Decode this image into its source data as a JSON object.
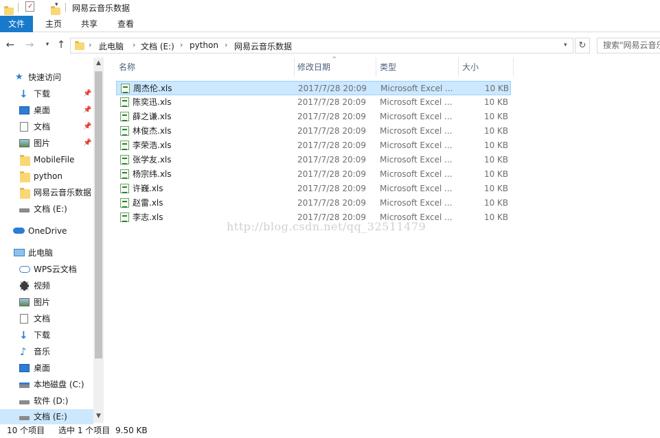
{
  "window": {
    "title": "网易云音乐数据"
  },
  "ribbon": {
    "tabs": [
      {
        "label": "文件"
      },
      {
        "label": "主页"
      },
      {
        "label": "共享"
      },
      {
        "label": "查看"
      }
    ]
  },
  "address": {
    "crumbs": [
      "此电脑",
      "文档 (E:)",
      "python",
      "网易云音乐数据"
    ],
    "search_placeholder": "搜索\"网易云音乐数据\""
  },
  "sidebar": {
    "items": [
      {
        "label": "快速访问",
        "icon": "star-icon"
      },
      {
        "label": "下载",
        "icon": "download-arrow-icon",
        "pinned": true
      },
      {
        "label": "桌面",
        "icon": "desktop-icon",
        "pinned": true
      },
      {
        "label": "文档",
        "icon": "document-icon",
        "pinned": true
      },
      {
        "label": "图片",
        "icon": "picture-icon",
        "pinned": true
      },
      {
        "label": "MobileFile",
        "icon": "folder-icon"
      },
      {
        "label": "python",
        "icon": "folder-icon"
      },
      {
        "label": "网易云音乐数据",
        "icon": "folder-icon"
      },
      {
        "label": "文档 (E:)",
        "icon": "drive-icon"
      },
      {
        "label": "OneDrive",
        "icon": "cloud-icon"
      },
      {
        "label": "此电脑",
        "icon": "computer-icon"
      },
      {
        "label": "WPS云文档",
        "icon": "wps-cloud-icon"
      },
      {
        "label": "视频",
        "icon": "video-icon"
      },
      {
        "label": "图片",
        "icon": "picture-icon"
      },
      {
        "label": "文档",
        "icon": "document-icon"
      },
      {
        "label": "下载",
        "icon": "download-arrow-icon"
      },
      {
        "label": "音乐",
        "icon": "music-note-icon"
      },
      {
        "label": "桌面",
        "icon": "desktop-icon"
      },
      {
        "label": "本地磁盘 (C:)",
        "icon": "drive-icon"
      },
      {
        "label": "软件 (D:)",
        "icon": "drive-icon"
      },
      {
        "label": "文档 (E:)",
        "icon": "drive-icon"
      }
    ]
  },
  "filelist": {
    "columns": {
      "name": "名称",
      "date": "修改日期",
      "type": "类型",
      "size": "大小"
    },
    "files": [
      {
        "name": "周杰伦.xls",
        "date": "2017/7/28 20:09",
        "type": "Microsoft Excel ...",
        "size": "10 KB"
      },
      {
        "name": "陈奕迅.xls",
        "date": "2017/7/28 20:09",
        "type": "Microsoft Excel ...",
        "size": "10 KB"
      },
      {
        "name": "薛之谦.xls",
        "date": "2017/7/28 20:09",
        "type": "Microsoft Excel ...",
        "size": "10 KB"
      },
      {
        "name": "林俊杰.xls",
        "date": "2017/7/28 20:09",
        "type": "Microsoft Excel ...",
        "size": "10 KB"
      },
      {
        "name": "李荣浩.xls",
        "date": "2017/7/28 20:09",
        "type": "Microsoft Excel ...",
        "size": "10 KB"
      },
      {
        "name": "张学友.xls",
        "date": "2017/7/28 20:09",
        "type": "Microsoft Excel ...",
        "size": "10 KB"
      },
      {
        "name": "杨宗纬.xls",
        "date": "2017/7/28 20:09",
        "type": "Microsoft Excel ...",
        "size": "10 KB"
      },
      {
        "name": "许巍.xls",
        "date": "2017/7/28 20:09",
        "type": "Microsoft Excel ...",
        "size": "10 KB"
      },
      {
        "name": "赵雷.xls",
        "date": "2017/7/28 20:09",
        "type": "Microsoft Excel ...",
        "size": "10 KB"
      },
      {
        "name": "李志.xls",
        "date": "2017/7/28 20:09",
        "type": "Microsoft Excel ...",
        "size": "10 KB"
      }
    ]
  },
  "watermark": "http://blog.csdn.net/qq_32511479",
  "status": {
    "count": "10 个项目",
    "selected": "选中 1 个项目",
    "size": "9.50 KB"
  }
}
